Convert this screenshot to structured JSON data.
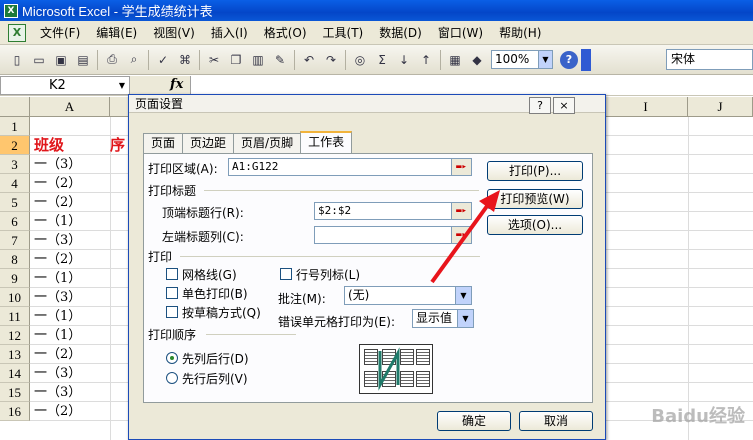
{
  "window": {
    "title": "Microsoft Excel - 学生成绩统计表"
  },
  "menu": [
    "文件(F)",
    "编辑(E)",
    "视图(V)",
    "插入(I)",
    "格式(O)",
    "工具(T)",
    "数据(D)",
    "窗口(W)",
    "帮助(H)"
  ],
  "toolbar": {
    "zoom": "100%",
    "font": "宋体"
  },
  "formula_bar": {
    "name_box": "K2",
    "fx": "fx"
  },
  "columns": [
    "A",
    "I",
    "J"
  ],
  "rows": [
    {
      "num": "1",
      "a": ""
    },
    {
      "num": "2",
      "a": "班级",
      "b": "序"
    },
    {
      "num": "3",
      "a": "一（3）"
    },
    {
      "num": "4",
      "a": "一（2）"
    },
    {
      "num": "5",
      "a": "一（2）"
    },
    {
      "num": "6",
      "a": "一（1）"
    },
    {
      "num": "7",
      "a": "一（3）"
    },
    {
      "num": "8",
      "a": "一（2）"
    },
    {
      "num": "9",
      "a": "一（1）"
    },
    {
      "num": "10",
      "a": "一（3）"
    },
    {
      "num": "11",
      "a": "一（1）"
    },
    {
      "num": "12",
      "a": "一（1）"
    },
    {
      "num": "13",
      "a": "一（2）"
    },
    {
      "num": "14",
      "a": "一（3）"
    },
    {
      "num": "15",
      "a": "一（3）"
    },
    {
      "num": "16",
      "a": "一（2）"
    }
  ],
  "dialog": {
    "title": "页面设置",
    "help": "?",
    "close": "×",
    "tabs": [
      "页面",
      "页边距",
      "页眉/页脚",
      "工作表"
    ],
    "print_area_label": "打印区域(A):",
    "print_area_value": "A1:G122",
    "print_titles_label": "打印标题",
    "top_rows_label": "顶端标题行(R):",
    "top_rows_value": "$2:$2",
    "left_cols_label": "左端标题列(C):",
    "left_cols_value": "",
    "print_section_label": "打印",
    "gridlines_label": "网格线(G)",
    "mono_label": "单色打印(B)",
    "draft_label": "按草稿方式(Q)",
    "row_col_headings_label": "行号列标(L)",
    "comments_label": "批注(M):",
    "comments_value": "(无)",
    "cell_errors_label": "错误单元格打印为(E):",
    "cell_errors_value": "显示值",
    "order_label": "打印顺序",
    "down_then_over": "先列后行(D)",
    "over_then_down": "先行后列(V)",
    "print_button": "打印(P)...",
    "preview_button": "打印预览(W)",
    "options_button": "选项(O)...",
    "ok_button": "确定",
    "cancel_button": "取消"
  },
  "watermark": "Baidu经验"
}
